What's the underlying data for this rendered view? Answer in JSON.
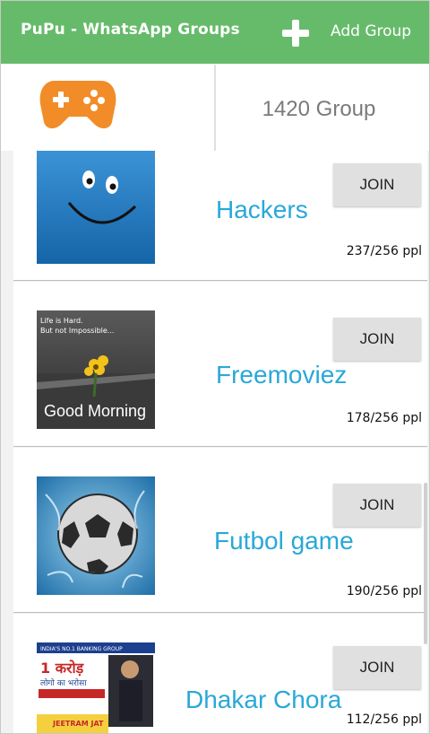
{
  "appbar": {
    "title": "PuPu - WhatsApp Groups",
    "add_label": "Add Group",
    "add_icon": "plus-icon",
    "color": "#66bb6a"
  },
  "header": {
    "icon": "gamepad-icon",
    "icon_color": "#f28c28",
    "group_count": "1420 Group"
  },
  "groups": [
    {
      "name": "Hackers",
      "join_label": "JOIN",
      "members": "237/256 ppl",
      "image": "smiley-face"
    },
    {
      "name": "Freemoviez",
      "join_label": "JOIN",
      "members": "178/256 ppl",
      "image": "good-morning-flower",
      "image_text": {
        "line1": "Life is Hard.",
        "line2": "But not Impossible...",
        "line3": "Good Morning"
      }
    },
    {
      "name": "Futbol game",
      "join_label": "JOIN",
      "members": "190/256 ppl",
      "image": "soccer-ball-splash"
    },
    {
      "name": "Dhakar Chora",
      "join_label": "JOIN",
      "members": "112/256 ppl",
      "image": "crore-poster",
      "image_text": {
        "banner": "INDIA'S NO.1 BANKING GROUP",
        "big": "1 करोड़",
        "sub": "लोगो का भरोसा",
        "bottom": "JEETRAM JAT"
      }
    }
  ],
  "accent_name_color": "#29a8d8"
}
